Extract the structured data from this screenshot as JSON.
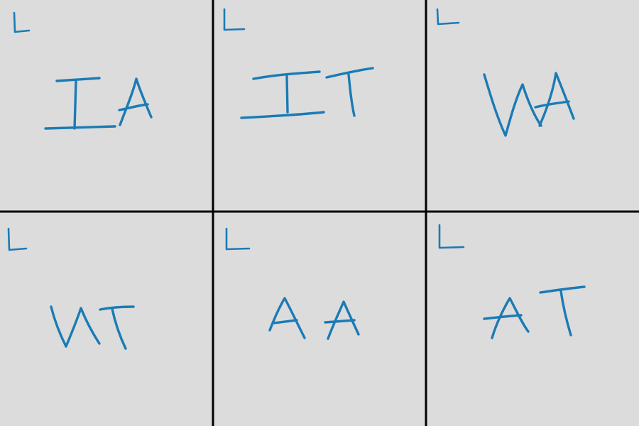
{
  "ink_color": "#1a7bb5",
  "background_color": "#dcdcdc",
  "grid_color": "#000000",
  "panels": [
    {
      "corner_mark": "L",
      "letters": [
        "I",
        "A"
      ]
    },
    {
      "corner_mark": "L",
      "letters": [
        "I",
        "T"
      ]
    },
    {
      "corner_mark": "L",
      "letters": [
        "W",
        "A"
      ]
    },
    {
      "corner_mark": "L",
      "letters": [
        "W",
        "T"
      ]
    },
    {
      "corner_mark": "L",
      "letters": [
        "A",
        "A"
      ]
    },
    {
      "corner_mark": "L",
      "letters": [
        "A",
        "T"
      ]
    }
  ]
}
